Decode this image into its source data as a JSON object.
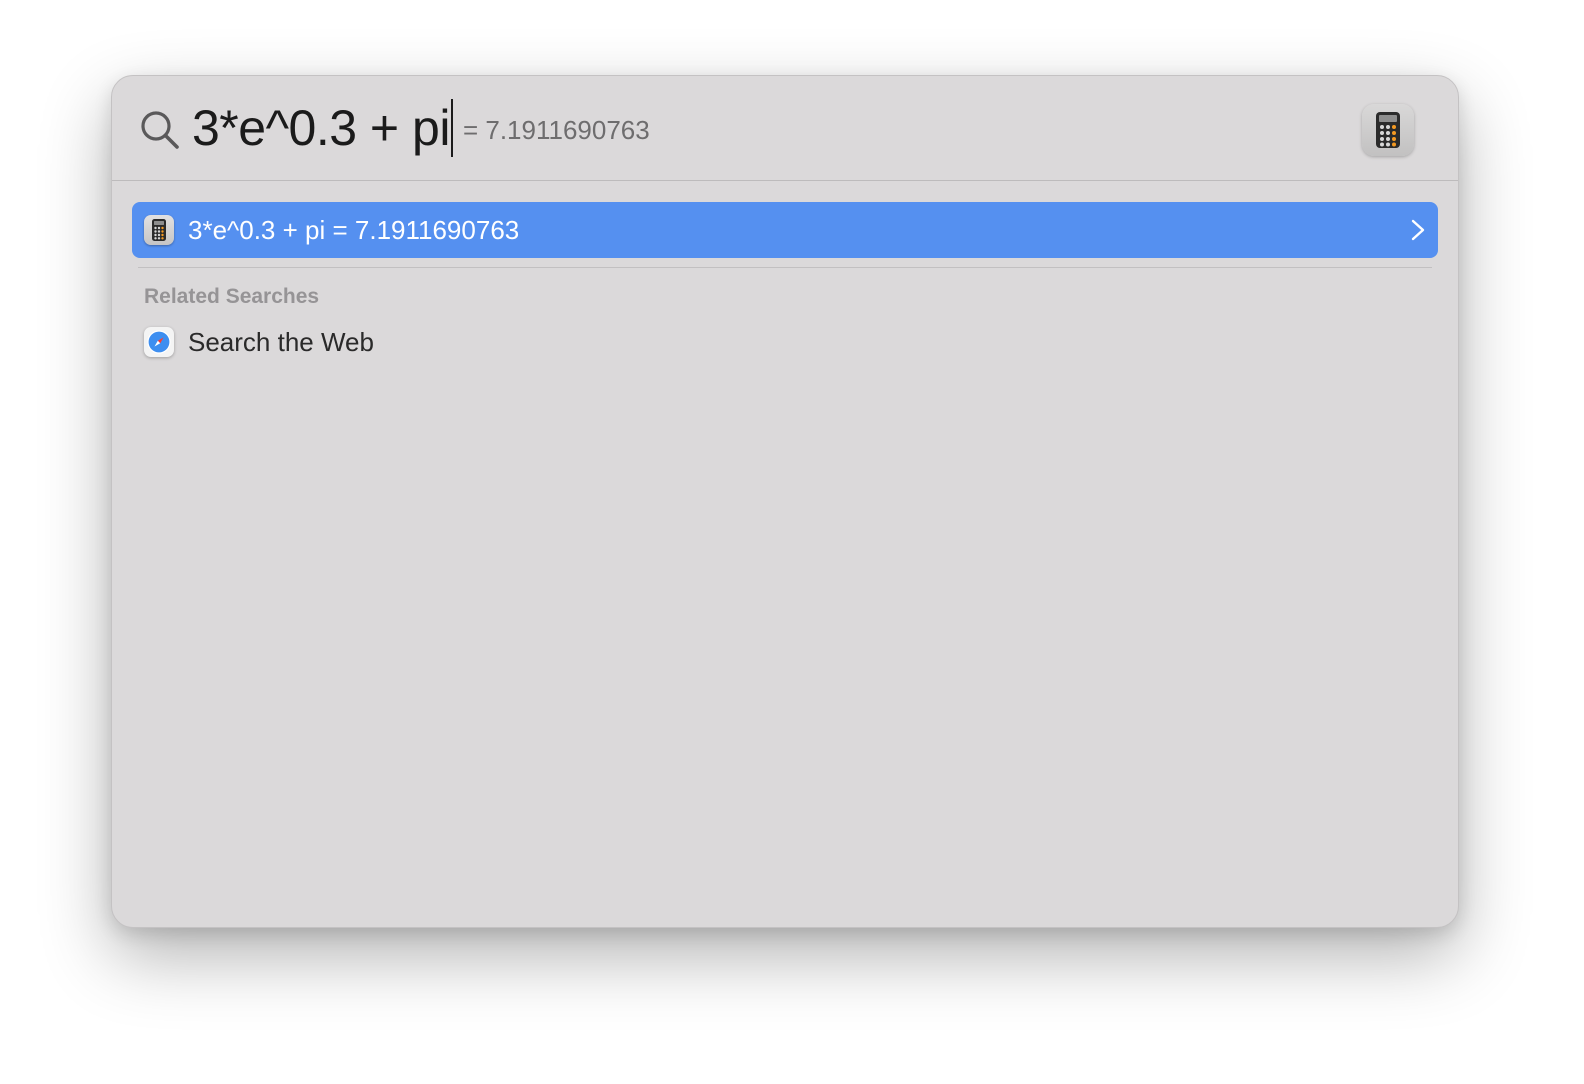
{
  "search": {
    "query": "3*e^0.3 + pi",
    "inline_result": "= 7.1911690763",
    "preview_app_icon": "calculator-icon"
  },
  "results": {
    "top_hit": {
      "icon": "calculator-icon",
      "label": "3*e^0.3 + pi = 7.1911690763",
      "selected": true
    },
    "related_header": "Related Searches",
    "related": [
      {
        "icon": "safari-icon",
        "label": "Search the Web"
      }
    ]
  },
  "colors": {
    "panel_background": "#dbd9da",
    "selection": "#5590f0",
    "section_header": "#969496"
  }
}
